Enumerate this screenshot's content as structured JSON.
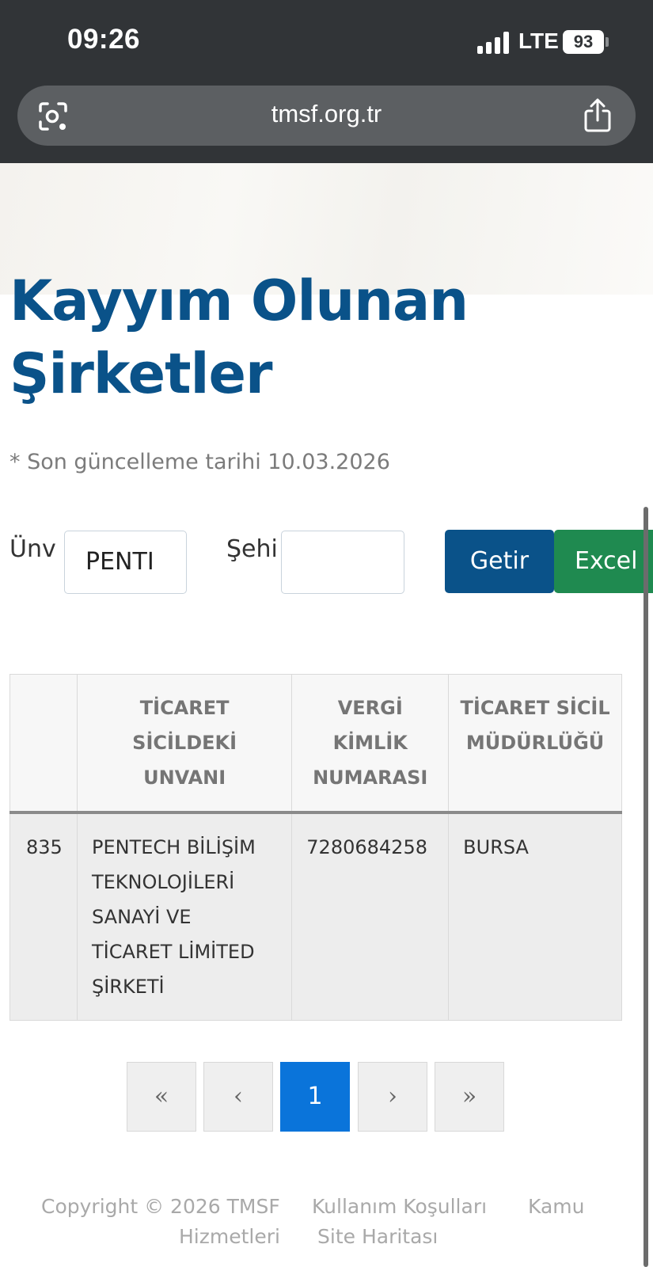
{
  "status_bar": {
    "time": "09:26",
    "network": "LTE",
    "battery": "93"
  },
  "browser": {
    "url": "tmsf.org.tr",
    "lens_icon": "camera-lens-icon",
    "share_icon": "share-icon"
  },
  "page": {
    "title_line1": "Kayyım Olunan",
    "title_line2": "Şirketler",
    "update_note": "* Son güncelleme tarihi 10.03.2026"
  },
  "filters": {
    "unvan_label": "Ünv",
    "unvan_value": "PENTI",
    "sehir_label": "Şehi",
    "sehir_value": "",
    "getir_button": "Getir",
    "excel_button": "Excel"
  },
  "table": {
    "headers": [
      "",
      "TİCARET SİCİLDEKİ UNVANI",
      "VERGİ KİMLİK NUMARASI",
      "TİCARET SİCİL MÜDÜRLÜĞÜ"
    ],
    "rows": [
      [
        "835",
        "PENTECH BİLİŞİM TEKNOLOJİLERİ SANAYİ VE TİCARET LİMİTED ŞİRKETİ",
        "7280684258",
        "BURSA"
      ]
    ]
  },
  "pagination": {
    "first": "«",
    "prev": "‹",
    "current": "1",
    "next": "›",
    "last": "»"
  },
  "footer": {
    "copyright": "Copyright © 2026 TMSF",
    "terms": "Kullanım Koşulları",
    "kamu": "Kamu",
    "hizmetleri": "Hizmetleri",
    "sitemap": "Site Haritası"
  },
  "colors": {
    "brand_blue": "#0a5289",
    "excel_green": "#1f8a50",
    "active_page": "#0a74da"
  }
}
